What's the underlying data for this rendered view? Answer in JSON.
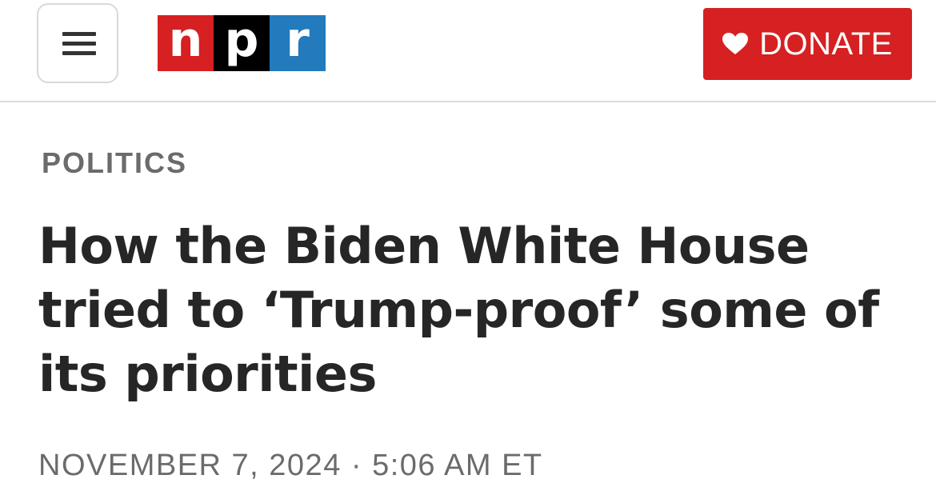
{
  "header": {
    "logo": {
      "letters": [
        "n",
        "p",
        "r"
      ],
      "colors": [
        "#d62021",
        "#000000",
        "#237bbd"
      ]
    },
    "menu_icon": "hamburger-menu-icon",
    "donate": {
      "label": "DONATE",
      "icon": "heart-icon",
      "background": "#d62021"
    }
  },
  "article": {
    "section": "POLITICS",
    "headline": "How the Biden White House tried to ‘Trump-proof’ some of its priorities",
    "date": "NOVEMBER 7, 2024",
    "separator": "·",
    "time": "5:06 AM ET"
  }
}
